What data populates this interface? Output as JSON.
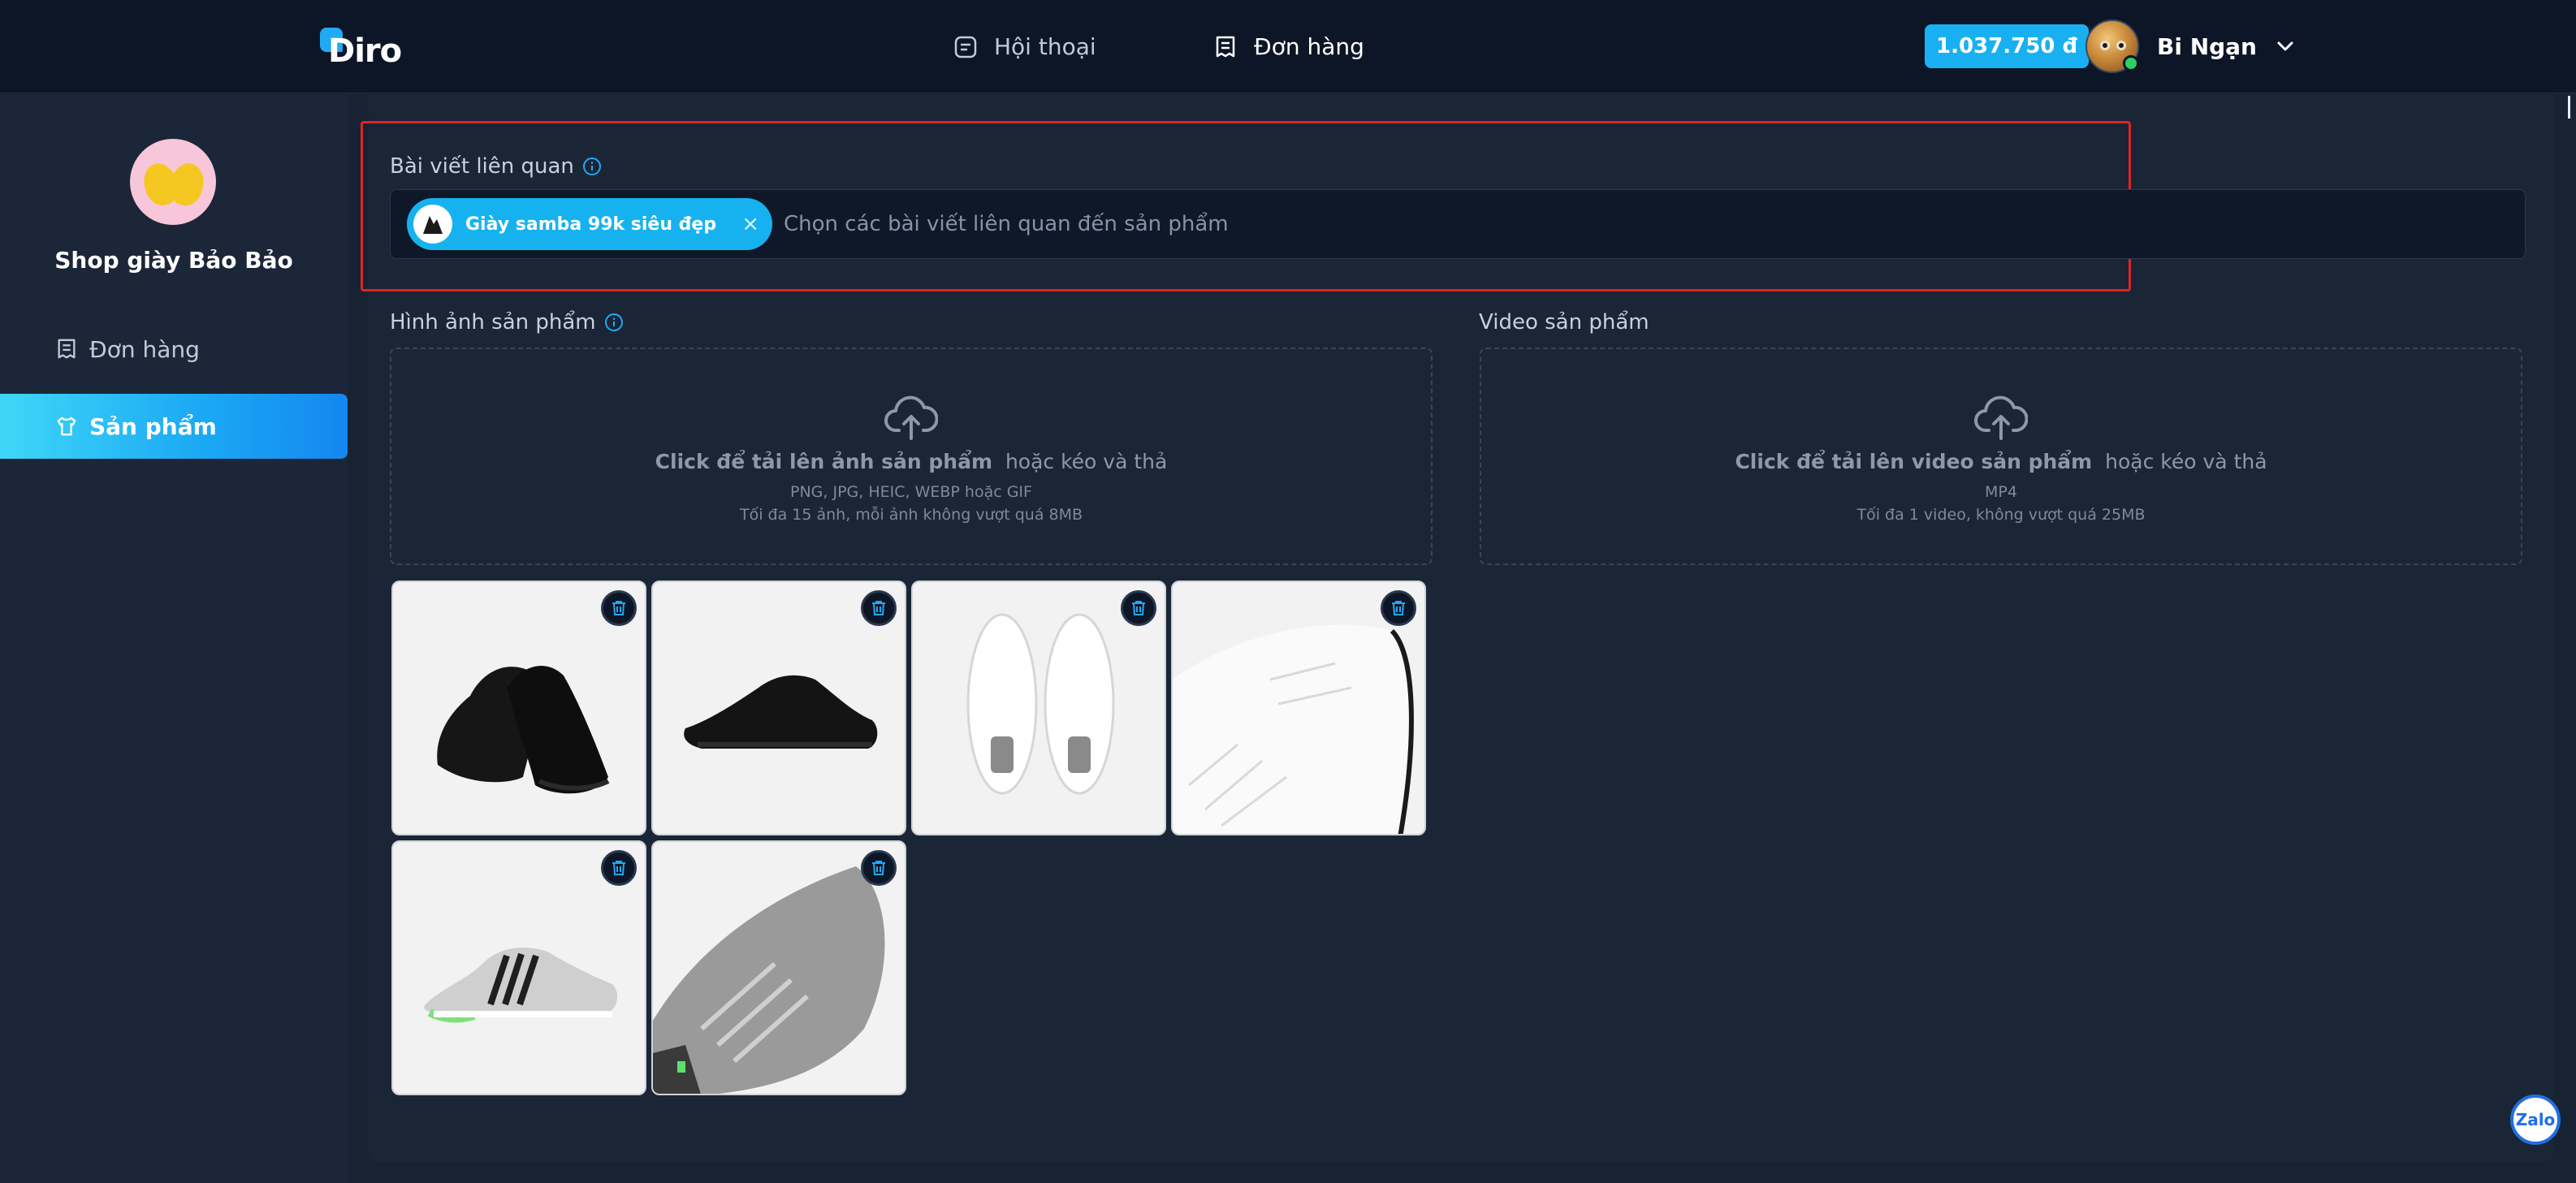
{
  "app": {
    "logo_text": "Diro",
    "brand_color": "#19b0f2"
  },
  "header": {
    "nav_chat": "Hội thoại",
    "nav_orders": "Đơn hàng",
    "balance": "1.037.750 đ",
    "user_name": "Bi Ngạn"
  },
  "sidebar": {
    "shop_name": "Shop giày Bảo Bảo",
    "items": [
      {
        "label": "Đơn hàng",
        "icon": "receipt-icon",
        "active": false
      },
      {
        "label": "Sản phẩm",
        "icon": "shirt-icon",
        "active": true
      }
    ]
  },
  "related_posts": {
    "label": "Bài viết liên quan",
    "chip_label": "Giày samba 99k siêu đẹp",
    "chip_close": "×",
    "placeholder": "Chọn các bài viết liên quan đến sản phẩm"
  },
  "images": {
    "label": "Hình ảnh sản phẩm",
    "upload_bold": "Click để tải lên ảnh sản phẩm",
    "upload_rest": "hoặc kéo và thả",
    "formats": "PNG, JPG, HEIC, WEBP hoặc GIF",
    "limit": "Tối đa 15 ảnh, mỗi ảnh không vượt quá 8MB",
    "items": [
      {
        "name": "black-shoe-pair"
      },
      {
        "name": "black-shoe-side"
      },
      {
        "name": "white-shoe-pair-top"
      },
      {
        "name": "white-shoe-closeup"
      },
      {
        "name": "grey-green-shoe-side"
      },
      {
        "name": "grey-shoe-closeup"
      }
    ]
  },
  "video": {
    "label": "Video sản phẩm",
    "upload_bold": "Click để tải lên video sản phẩm",
    "upload_rest": "hoặc kéo và thả",
    "formats": "MP4",
    "limit": "Tối đa 1 video, không vượt quá 25MB"
  },
  "zalo": {
    "label": "Zalo"
  }
}
